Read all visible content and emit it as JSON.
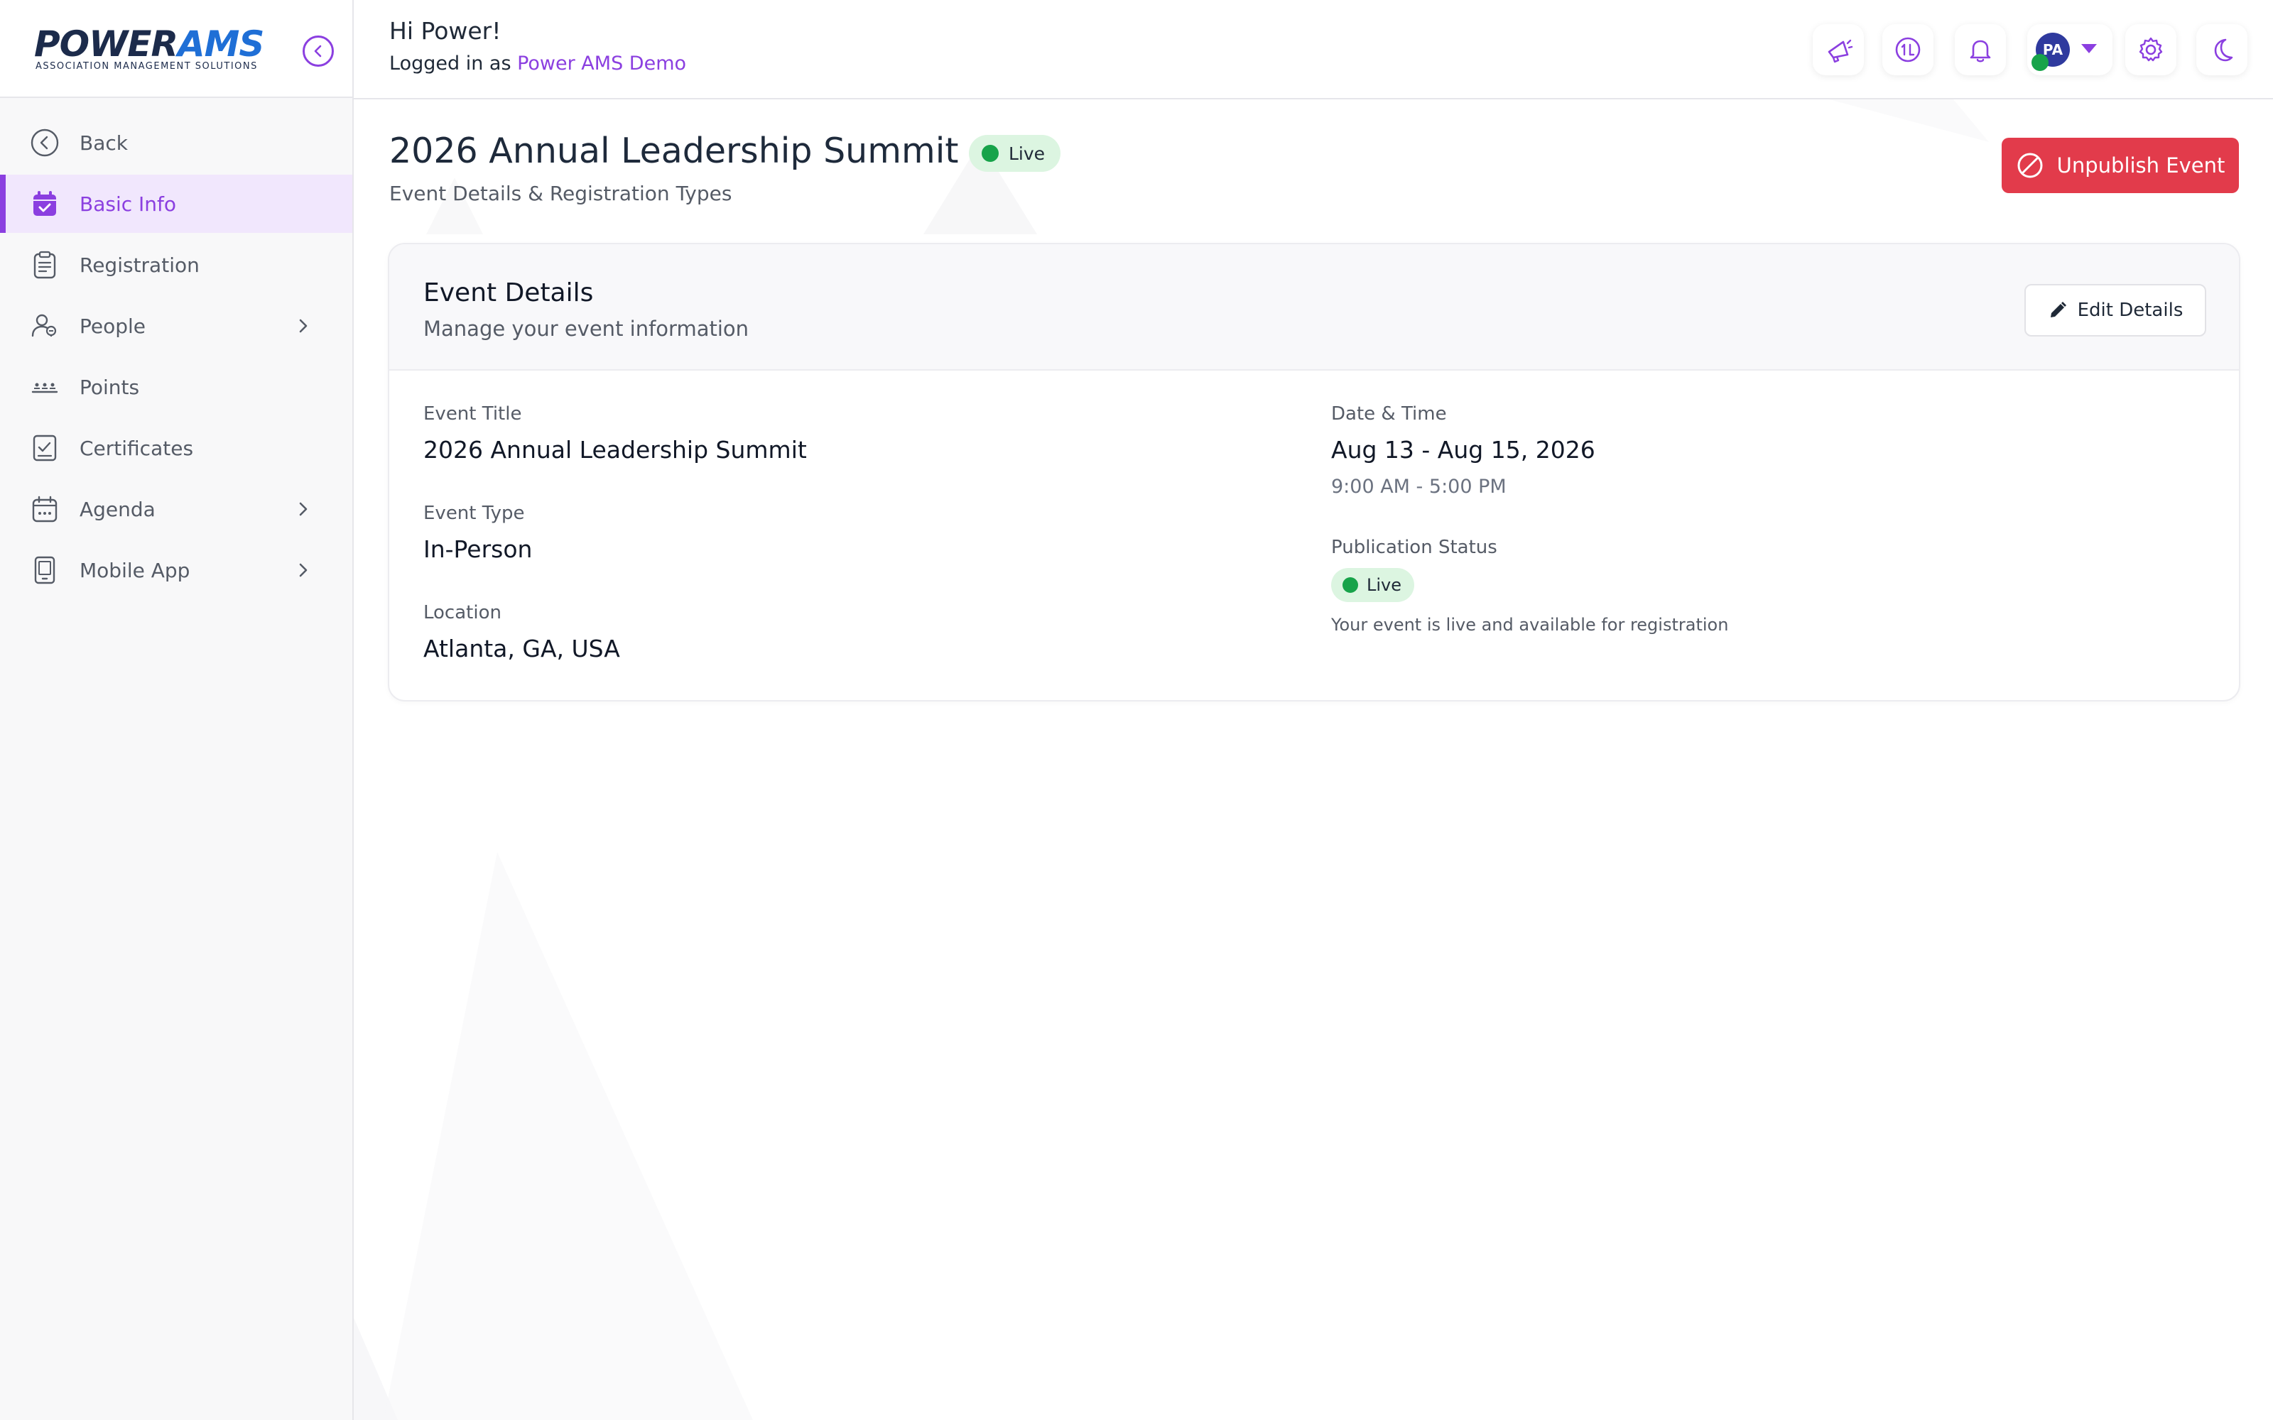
{
  "brand": {
    "name_part1": "POWER",
    "name_part2": "AMS",
    "tagline": "ASSOCIATION MANAGEMENT SOLUTIONS",
    "primary_color": "#8b3fe0",
    "logo_dark": "#1c2b4b",
    "logo_blue": "#1f6fd6"
  },
  "header": {
    "greeting": "Hi Power!",
    "logged_in_prefix": "Logged in as ",
    "account_name": "Power AMS Demo",
    "avatar_initials": "PA",
    "icons": [
      "megaphone-icon",
      "coin-icon",
      "bell-icon",
      "gear-icon",
      "moon-icon"
    ]
  },
  "sidebar": {
    "items": [
      {
        "label": "Back",
        "icon": "back-circle-icon",
        "active": false,
        "has_children": false
      },
      {
        "label": "Basic Info",
        "icon": "calendar-check-icon",
        "active": true,
        "has_children": false
      },
      {
        "label": "Registration",
        "icon": "clipboard-icon",
        "active": false,
        "has_children": false
      },
      {
        "label": "People",
        "icon": "people-icon",
        "active": false,
        "has_children": true
      },
      {
        "label": "Points",
        "icon": "points-icon",
        "active": false,
        "has_children": false
      },
      {
        "label": "Certificates",
        "icon": "certificate-icon",
        "active": false,
        "has_children": false
      },
      {
        "label": "Agenda",
        "icon": "agenda-calendar-icon",
        "active": false,
        "has_children": true
      },
      {
        "label": "Mobile App",
        "icon": "mobile-icon",
        "active": false,
        "has_children": true
      }
    ]
  },
  "page": {
    "title": "2026 Annual Leadership Summit",
    "status_badge": "Live",
    "subtitle": "Event Details & Registration Types",
    "unpublish_label": "Unpublish Event",
    "danger_color": "#e23b4b",
    "live_color": "#17a34a"
  },
  "card": {
    "title": "Event Details",
    "subtitle": "Manage your event information",
    "edit_label": "Edit Details",
    "fields": {
      "event_title_label": "Event Title",
      "event_title_value": "2026 Annual Leadership Summit",
      "event_type_label": "Event Type",
      "event_type_value": "In-Person",
      "location_label": "Location",
      "location_value": "Atlanta, GA, USA",
      "date_label": "Date & Time",
      "date_value": "Aug 13 - Aug 15, 2026",
      "time_value": "9:00 AM - 5:00 PM",
      "publication_label": "Publication Status",
      "publication_badge": "Live",
      "publication_note": "Your event is live and available for registration"
    }
  }
}
